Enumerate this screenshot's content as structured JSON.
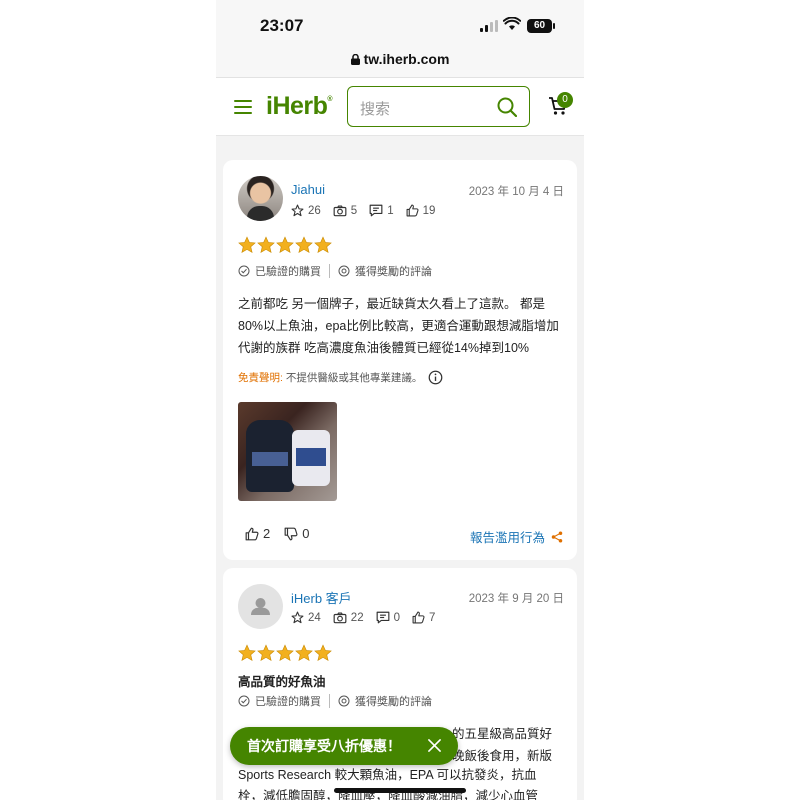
{
  "status_bar": {
    "time": "23:07",
    "battery": "60"
  },
  "url_bar": {
    "url": "tw.iherb.com"
  },
  "header": {
    "logo": "iHerb",
    "search_placeholder": "搜索",
    "cart_count": "0"
  },
  "reviews": [
    {
      "author": "Jiahui",
      "date": "2023 年 10 月 4 日",
      "stats": {
        "stars": "26",
        "photos": "5",
        "comments": "1",
        "likes": "19"
      },
      "rating": 5,
      "title": "",
      "verified": "已驗證的購買",
      "rewarded": "獲得獎勵的評論",
      "text": "之前都吃 另一個牌子，最近缺貨太久看上了這款。 都是80%以上魚油，epa比例比較高，更適合運動跟想減脂增加代謝的族群 吃高濃度魚油後體質已經從14%掉到10%",
      "disclaimer_label": "免責聲明:",
      "disclaimer_text": "不提供醫級或其他專業建議。",
      "helpful": "2",
      "unhelpful": "0",
      "report": "報告濫用行為"
    },
    {
      "author": "iHerb 客戶",
      "date": "2023 年 9 月 20 日",
      "stats": {
        "stars": "24",
        "photos": "22",
        "comments": "0",
        "likes": "7"
      },
      "rating": 5,
      "title": "高品質的好魚油",
      "verified": "已驗證的購買",
      "rewarded": "獲得獎勵的評論",
      "text_line1": "的五星級高品質好",
      "text_line2": "晚飯後食用，新版",
      "text_line3": "Sports Research 較大顆魚油，EPA 可以抗發炎，抗血",
      "text_line4": "栓，減低膽固醇，降血壓，降血酸減油脂，減少心血管"
    }
  ],
  "toast": {
    "text": "首次訂購享受八折優惠！"
  },
  "colors": {
    "brand_green": "#458500",
    "link_blue": "#1a74b5",
    "star_gold": "#f2b01e",
    "disclaimer_orange": "#e07000"
  }
}
